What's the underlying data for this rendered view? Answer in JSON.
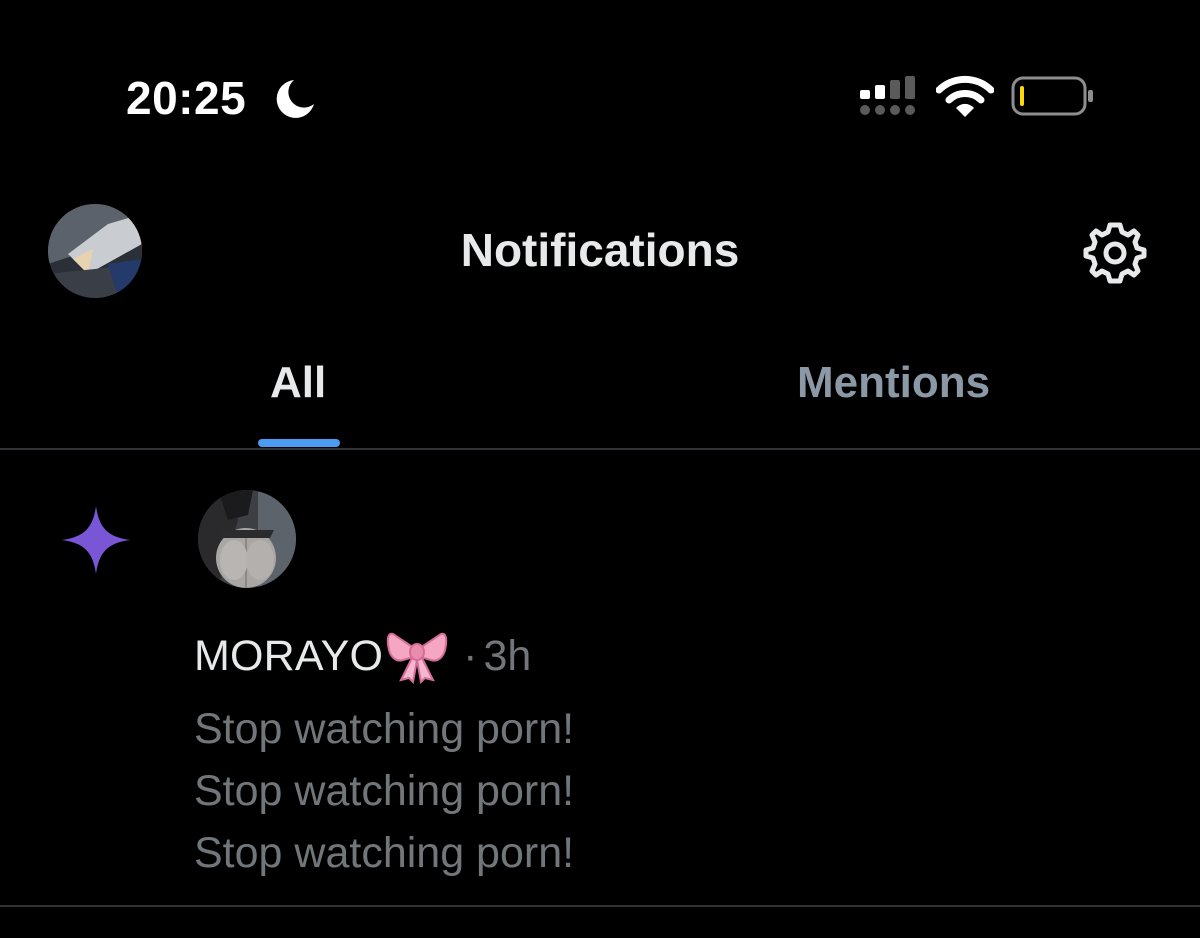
{
  "status_bar": {
    "time": "20:25",
    "icons": [
      "moon-icon",
      "signal-icon",
      "wifi-icon",
      "battery-icon"
    ]
  },
  "header": {
    "title": "Notifications",
    "avatar_icon": "avatar",
    "settings_icon": "gear-icon"
  },
  "tabs": [
    {
      "label": "All",
      "active": true
    },
    {
      "label": "Mentions",
      "active": false
    }
  ],
  "notification": {
    "type_icon": "sparkle-icon",
    "user_name": "MORAYO",
    "name_emoji": "ribbon-bow-icon",
    "separator": "·",
    "time": "3h",
    "message_lines": [
      "Stop watching porn!",
      "Stop watching porn!",
      "Stop watching porn!"
    ]
  },
  "colors": {
    "background": "#000000",
    "primary_text": "#e7e9ea",
    "secondary_text": "#71767b",
    "inactive_tab": "#8b98a5",
    "tab_indicator": "#4b9cf0",
    "divider": "#2f3336",
    "sparkle": "#7856d6",
    "bow": "#f4a6c3"
  }
}
